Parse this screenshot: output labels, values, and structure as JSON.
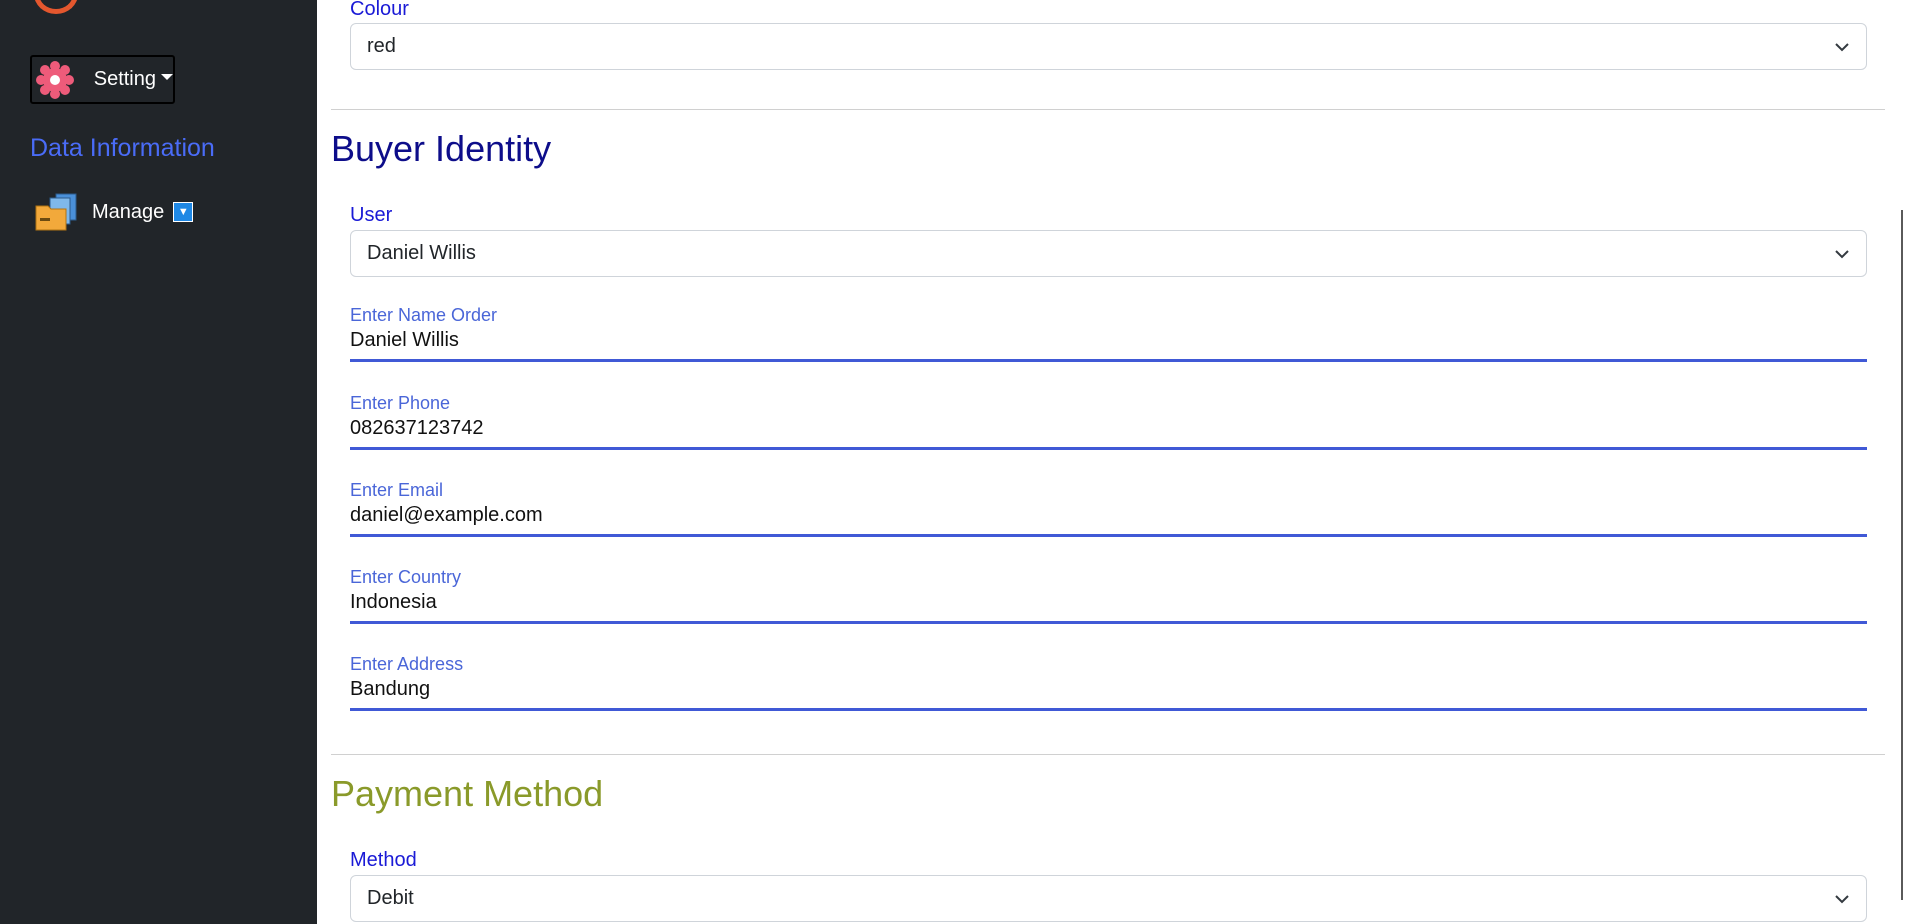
{
  "sidebar": {
    "setting_label": "Setting",
    "section_heading": "Data Information",
    "manage_label": "Manage",
    "manage_toggle_glyph": "▼"
  },
  "colour": {
    "label": "Colour",
    "value": "red"
  },
  "buyer": {
    "title": "Buyer Identity",
    "title_color": "#0d0d8a",
    "user_label": "User",
    "user_value": "Daniel Willis",
    "fields": [
      {
        "label": "Enter Name Order",
        "value": "Daniel Willis"
      },
      {
        "label": "Enter Phone",
        "value": "082637123742"
      },
      {
        "label": "Enter Email",
        "value": "daniel@example.com"
      },
      {
        "label": "Enter Country",
        "value": "Indonesia"
      },
      {
        "label": "Enter Address",
        "value": "Bandung"
      }
    ]
  },
  "payment": {
    "title": "Payment Method",
    "title_color": "#8a9a2a",
    "method_label": "Method",
    "method_value": "Debit"
  },
  "colors": {
    "sidebar_bg": "#212529",
    "accent_blue": "#4059d6",
    "label_blue": "#1a1ad6"
  },
  "icons": {
    "setting": "gear-icon",
    "manage": "folder-icon",
    "select": "chevron-down-icon"
  }
}
